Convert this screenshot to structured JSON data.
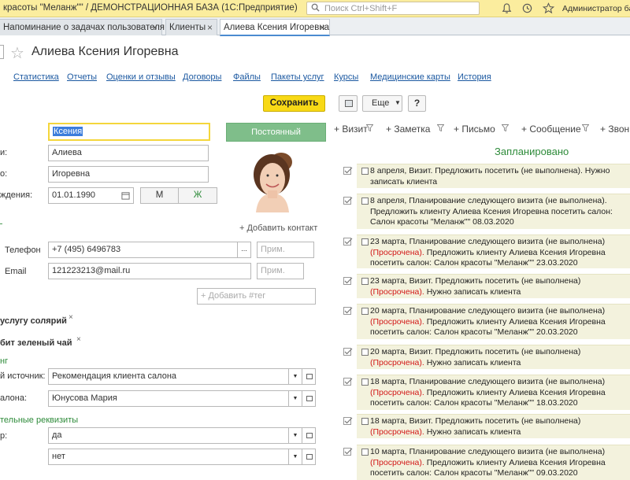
{
  "titlebar": {
    "title": "красоты \"Меланж\"\" / ДЕМОНСТРАЦИОННАЯ БАЗА (1С:Предприятие)",
    "search_placeholder": "Поиск Ctrl+Shift+F",
    "user": "Администратор базы"
  },
  "tabs": [
    {
      "label": "Напоминание о задачах пользователя"
    },
    {
      "label": "Клиенты"
    },
    {
      "label": "Алиева Ксения Игоревна"
    }
  ],
  "page_title": "Алиева Ксения Игоревна",
  "nav": [
    "Статистика",
    "Отчеты",
    "Оценки и отзывы",
    "Договоры",
    "Файлы",
    "Пакеты услуг",
    "Курсы",
    "Медицинские карты",
    "История"
  ],
  "toolbar": {
    "save": "Сохранить",
    "more": "Еще",
    "help": "?"
  },
  "form": {
    "first_name": "Ксения",
    "last_name_label": "и:",
    "last_name": "Алиева",
    "middle_name_label": "о:",
    "middle_name": "Игоревна",
    "birth_label": "ждения:",
    "birth_date": "01.01.1990",
    "gender_m": "М",
    "gender_f": "Ж",
    "status": "Постоянный",
    "add_contact": "+ Добавить контакт",
    "phone_label": "Телефон",
    "phone": "+7 (495) 6496783",
    "phone_note_ph": "Прим.",
    "email_label": "Email",
    "email": "121223213@mail.ru",
    "email_note_ph": "Прим.",
    "tag_ph": "+ Добавить #тег",
    "service1": "услугу солярий",
    "service2": "бит зеленый чай",
    "section_marketing": "нг",
    "source_label": "й источник:",
    "source": "Рекомендация клиента салона",
    "salon_label": "алона:",
    "salon": "Юнусова Мария",
    "section_extra": "тельные реквизиты",
    "extra1_label": "р:",
    "extra1": "да",
    "extra2": "нет"
  },
  "right": {
    "actions": [
      "+ Визит",
      "+ Заметка",
      "+ Письмо",
      "+ Сообщение",
      "+ Звон"
    ],
    "planned_header": "Запланировано",
    "events": [
      {
        "parts": [
          {
            "t": "8 апреля, Визит. Предложить посетить (не выполнена). Нужно записать клиента",
            "red": false
          }
        ]
      },
      {
        "parts": [
          {
            "t": "8 апреля, Планирование следующего визита (не выполнена). Предложить клиенту Алиева Ксения Игоревна посетить салон: Салон красоты \"Меланж\"\" 08.03.2020",
            "red": false
          }
        ]
      },
      {
        "parts": [
          {
            "t": "23 марта, Планирование следующего визита (не выполнена) ",
            "red": false
          },
          {
            "t": "(Просрочена).",
            "red": true
          },
          {
            "t": " Предложить клиенту Алиева Ксения Игоревна посетить салон: Салон красоты \"Меланж\"\" 23.03.2020",
            "red": false
          }
        ]
      },
      {
        "parts": [
          {
            "t": "23 марта, Визит. Предложить посетить (не выполнена) ",
            "red": false
          },
          {
            "t": "(Просрочена).",
            "red": true
          },
          {
            "t": " Нужно записать клиента",
            "red": false
          }
        ]
      },
      {
        "parts": [
          {
            "t": "20 марта, Планирование следующего визита (не выполнена) ",
            "red": false
          },
          {
            "t": "(Просрочена).",
            "red": true
          },
          {
            "t": " Предложить клиенту Алиева Ксения Игоревна посетить салон: Салон красоты \"Меланж\"\" 20.03.2020",
            "red": false
          }
        ]
      },
      {
        "parts": [
          {
            "t": "20 марта, Визит. Предложить посетить (не выполнена) ",
            "red": false
          },
          {
            "t": "(Просрочена).",
            "red": true
          },
          {
            "t": " Нужно записать клиента",
            "red": false
          }
        ]
      },
      {
        "parts": [
          {
            "t": "18 марта, Планирование следующего визита (не выполнена) ",
            "red": false
          },
          {
            "t": "(Просрочена).",
            "red": true
          },
          {
            "t": " Предложить клиенту Алиева Ксения Игоревна посетить салон: Салон красоты \"Меланж\"\" 18.03.2020",
            "red": false
          }
        ]
      },
      {
        "parts": [
          {
            "t": "18 марта, Визит. Предложить посетить (не выполнена) ",
            "red": false
          },
          {
            "t": "(Просрочена).",
            "red": true
          },
          {
            "t": " Нужно записать клиента",
            "red": false
          }
        ]
      },
      {
        "parts": [
          {
            "t": "10 марта, Планирование следующего визита (не выполнена) ",
            "red": false
          },
          {
            "t": "(Просрочена).",
            "red": true
          },
          {
            "t": " Предложить клиенту Алиева Ксения Игоревна посетить салон: Салон красоты \"Меланж\"\" 09.03.2020",
            "red": false
          }
        ]
      }
    ]
  },
  "colors": {
    "titlebar": "#fbed9e",
    "save": "#f8d916",
    "status": "#7fbe8a",
    "link": "#1c59a1",
    "overdue": "#d21818",
    "planned": "#2e8b3a",
    "event_bg": "#f3f2dd"
  },
  "icons": [
    "search-icon",
    "bell-icon",
    "history-icon",
    "star-icon",
    "calendar-icon",
    "funnel-icon",
    "check-icon"
  ]
}
